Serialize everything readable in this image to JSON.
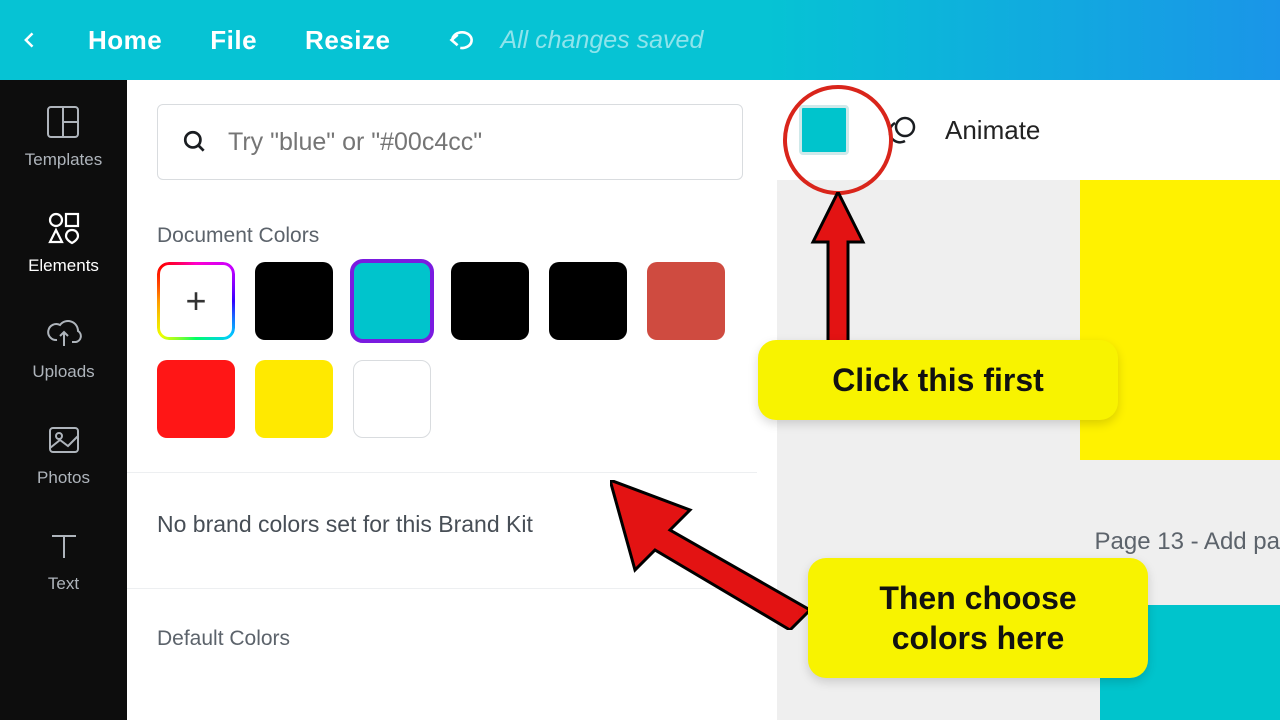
{
  "topbar": {
    "home": "Home",
    "file": "File",
    "resize": "Resize",
    "saved": "All changes saved"
  },
  "sidebar": {
    "items": [
      {
        "id": "templates",
        "label": "Templates"
      },
      {
        "id": "elements",
        "label": "Elements"
      },
      {
        "id": "uploads",
        "label": "Uploads"
      },
      {
        "id": "photos",
        "label": "Photos"
      },
      {
        "id": "text",
        "label": "Text"
      }
    ]
  },
  "panel": {
    "search_placeholder": "Try \"blue\" or \"#00c4cc\"",
    "doc_colors_label": "Document Colors",
    "brand_kit_text": "No brand colors set for this Brand Kit",
    "default_colors_label": "Default Colors",
    "doc_colors": [
      {
        "id": "add",
        "type": "add"
      },
      {
        "id": "black1",
        "hex": "#000000"
      },
      {
        "id": "teal",
        "hex": "#00c4cc",
        "selected": true
      },
      {
        "id": "black2",
        "hex": "#000000"
      },
      {
        "id": "black3",
        "hex": "#000000"
      },
      {
        "id": "brick",
        "hex": "#cf4b40"
      },
      {
        "id": "red",
        "hex": "#ff1616"
      },
      {
        "id": "yellow",
        "hex": "#ffe900"
      },
      {
        "id": "white",
        "hex": "#ffffff",
        "border": true
      }
    ]
  },
  "right": {
    "animate_label": "Animate",
    "page_label": "Page 13 - Add pa",
    "current_color": "#00c4cc"
  },
  "annotations": {
    "callout1": "Click this first",
    "callout2": "Then choose colors here"
  }
}
